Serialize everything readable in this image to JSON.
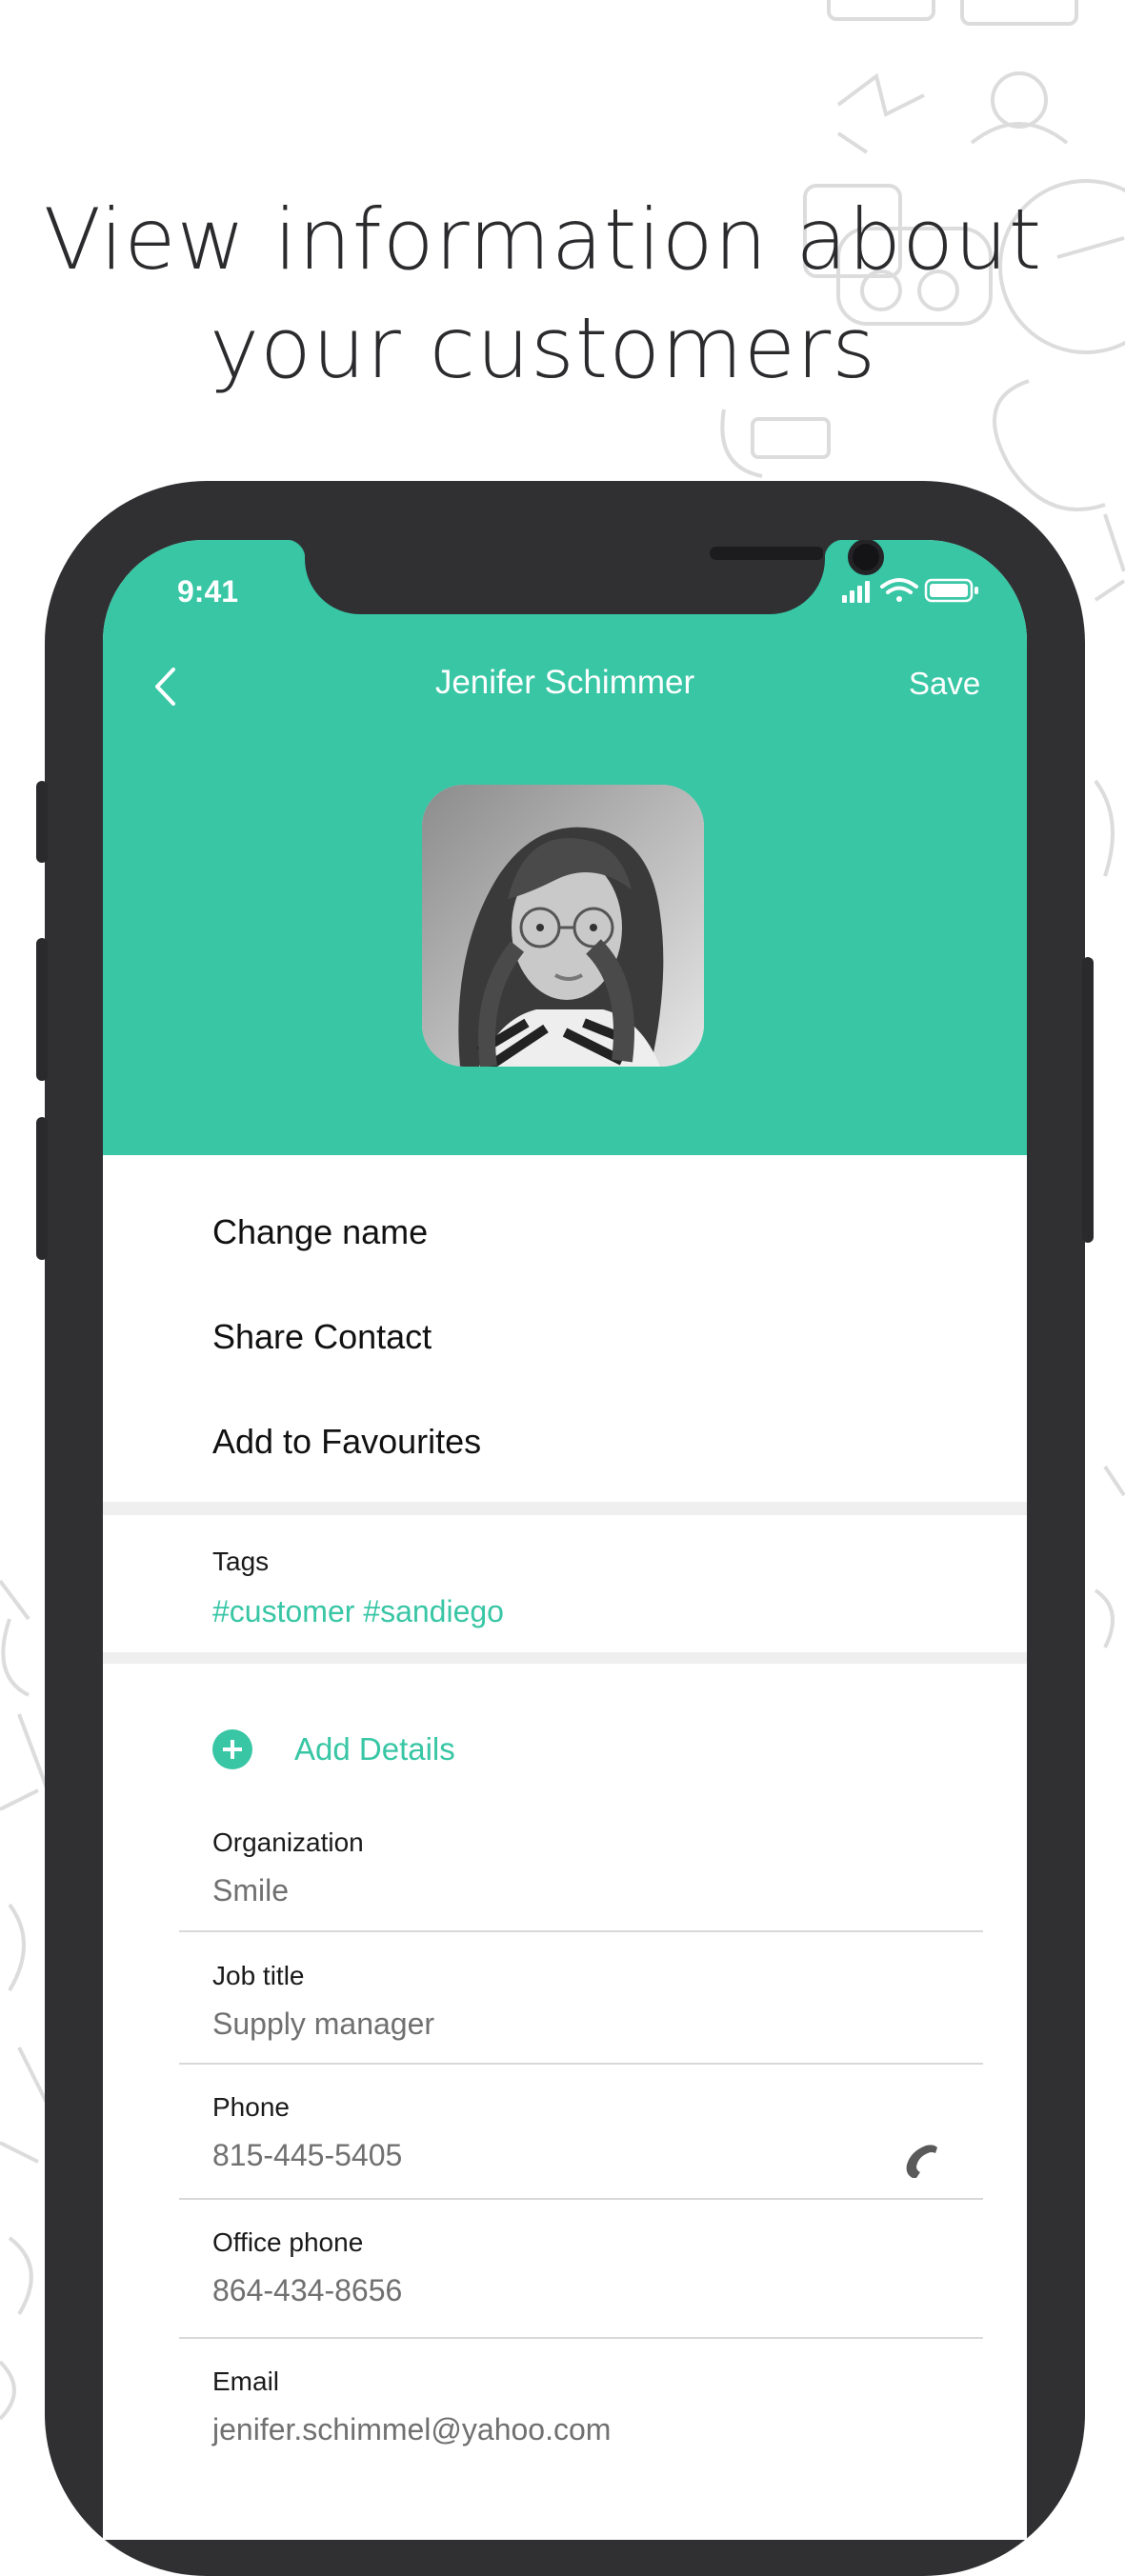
{
  "headline": {
    "line1": "View information about",
    "line2": "your customers"
  },
  "status_bar": {
    "time": "9:41",
    "icons": [
      "signal-icon",
      "wifi-icon",
      "battery-icon"
    ]
  },
  "nav": {
    "back_icon": "chevron-left-icon",
    "title": "Jenifer Schimmer",
    "save_label": "Save"
  },
  "colors": {
    "accent": "#38c6a5",
    "device": "#303033",
    "text": "#111111",
    "muted": "#707070"
  },
  "actions": [
    "Change name",
    "Share Contact",
    "Add to Favourites"
  ],
  "tags": {
    "label": "Tags",
    "value": "#customer #sandiego"
  },
  "add_details": {
    "icon": "plus-circle-icon",
    "label": "Add Details"
  },
  "fields": [
    {
      "label": "Organization",
      "value": "Smile"
    },
    {
      "label": "Job title",
      "value": "Supply manager"
    },
    {
      "label": "Phone",
      "value": "815-445-5405",
      "icon": "phone-icon"
    },
    {
      "label": "Office phone",
      "value": "864-434-8656"
    },
    {
      "label": "Email",
      "value": "jenifer.schimmel@yahoo.com"
    }
  ]
}
